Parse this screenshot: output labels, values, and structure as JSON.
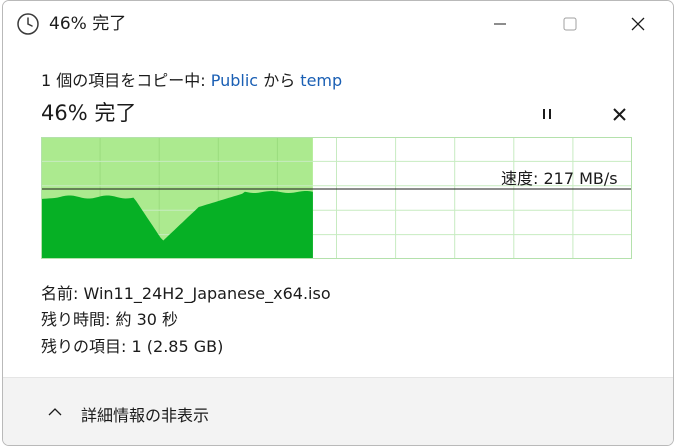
{
  "window": {
    "title": "46% 完了",
    "clock_icon": "clock-icon",
    "caption_buttons": [
      "minimize-icon",
      "maximize-icon",
      "close-icon"
    ]
  },
  "copy": {
    "prefix": "1 個の項目をコピー中: ",
    "source": "Public",
    "middle": " から ",
    "destination": "temp"
  },
  "progress": {
    "heading": "46% 完了",
    "percent": 46,
    "pause_icon": "pause-icon",
    "cancel_icon": "close-icon"
  },
  "speed": {
    "label": "速度: 217 MB/s"
  },
  "details": {
    "name_label": "名前:",
    "name_value": "Win11_24H2_Japanese_x64.iso",
    "time_label": "残り時間:",
    "time_value": "約 30 秒",
    "items_label": "残りの項目:",
    "items_value": "1 (2.85 GB)"
  },
  "footer": {
    "toggle_label": "詳細情報の非表示",
    "toggle_icon": "chevron-up-icon"
  },
  "colors": {
    "link": "#1a5fb4",
    "graph_fill": "#06b025",
    "graph_progress_bg": "#acea8f",
    "graph_grid": "#c7ebc1",
    "graph_border": "#b4e1ac"
  }
}
